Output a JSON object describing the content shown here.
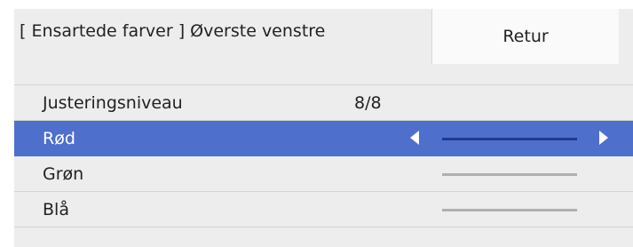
{
  "header": {
    "title": "[ Ensartede farver ] Øverste venstre",
    "return_button": "Retur"
  },
  "rows": [
    {
      "label": "Justeringsniveau",
      "value": "8/8"
    },
    {
      "label": "Rød",
      "selected": true
    },
    {
      "label": "Grøn"
    },
    {
      "label": "Blå"
    }
  ]
}
